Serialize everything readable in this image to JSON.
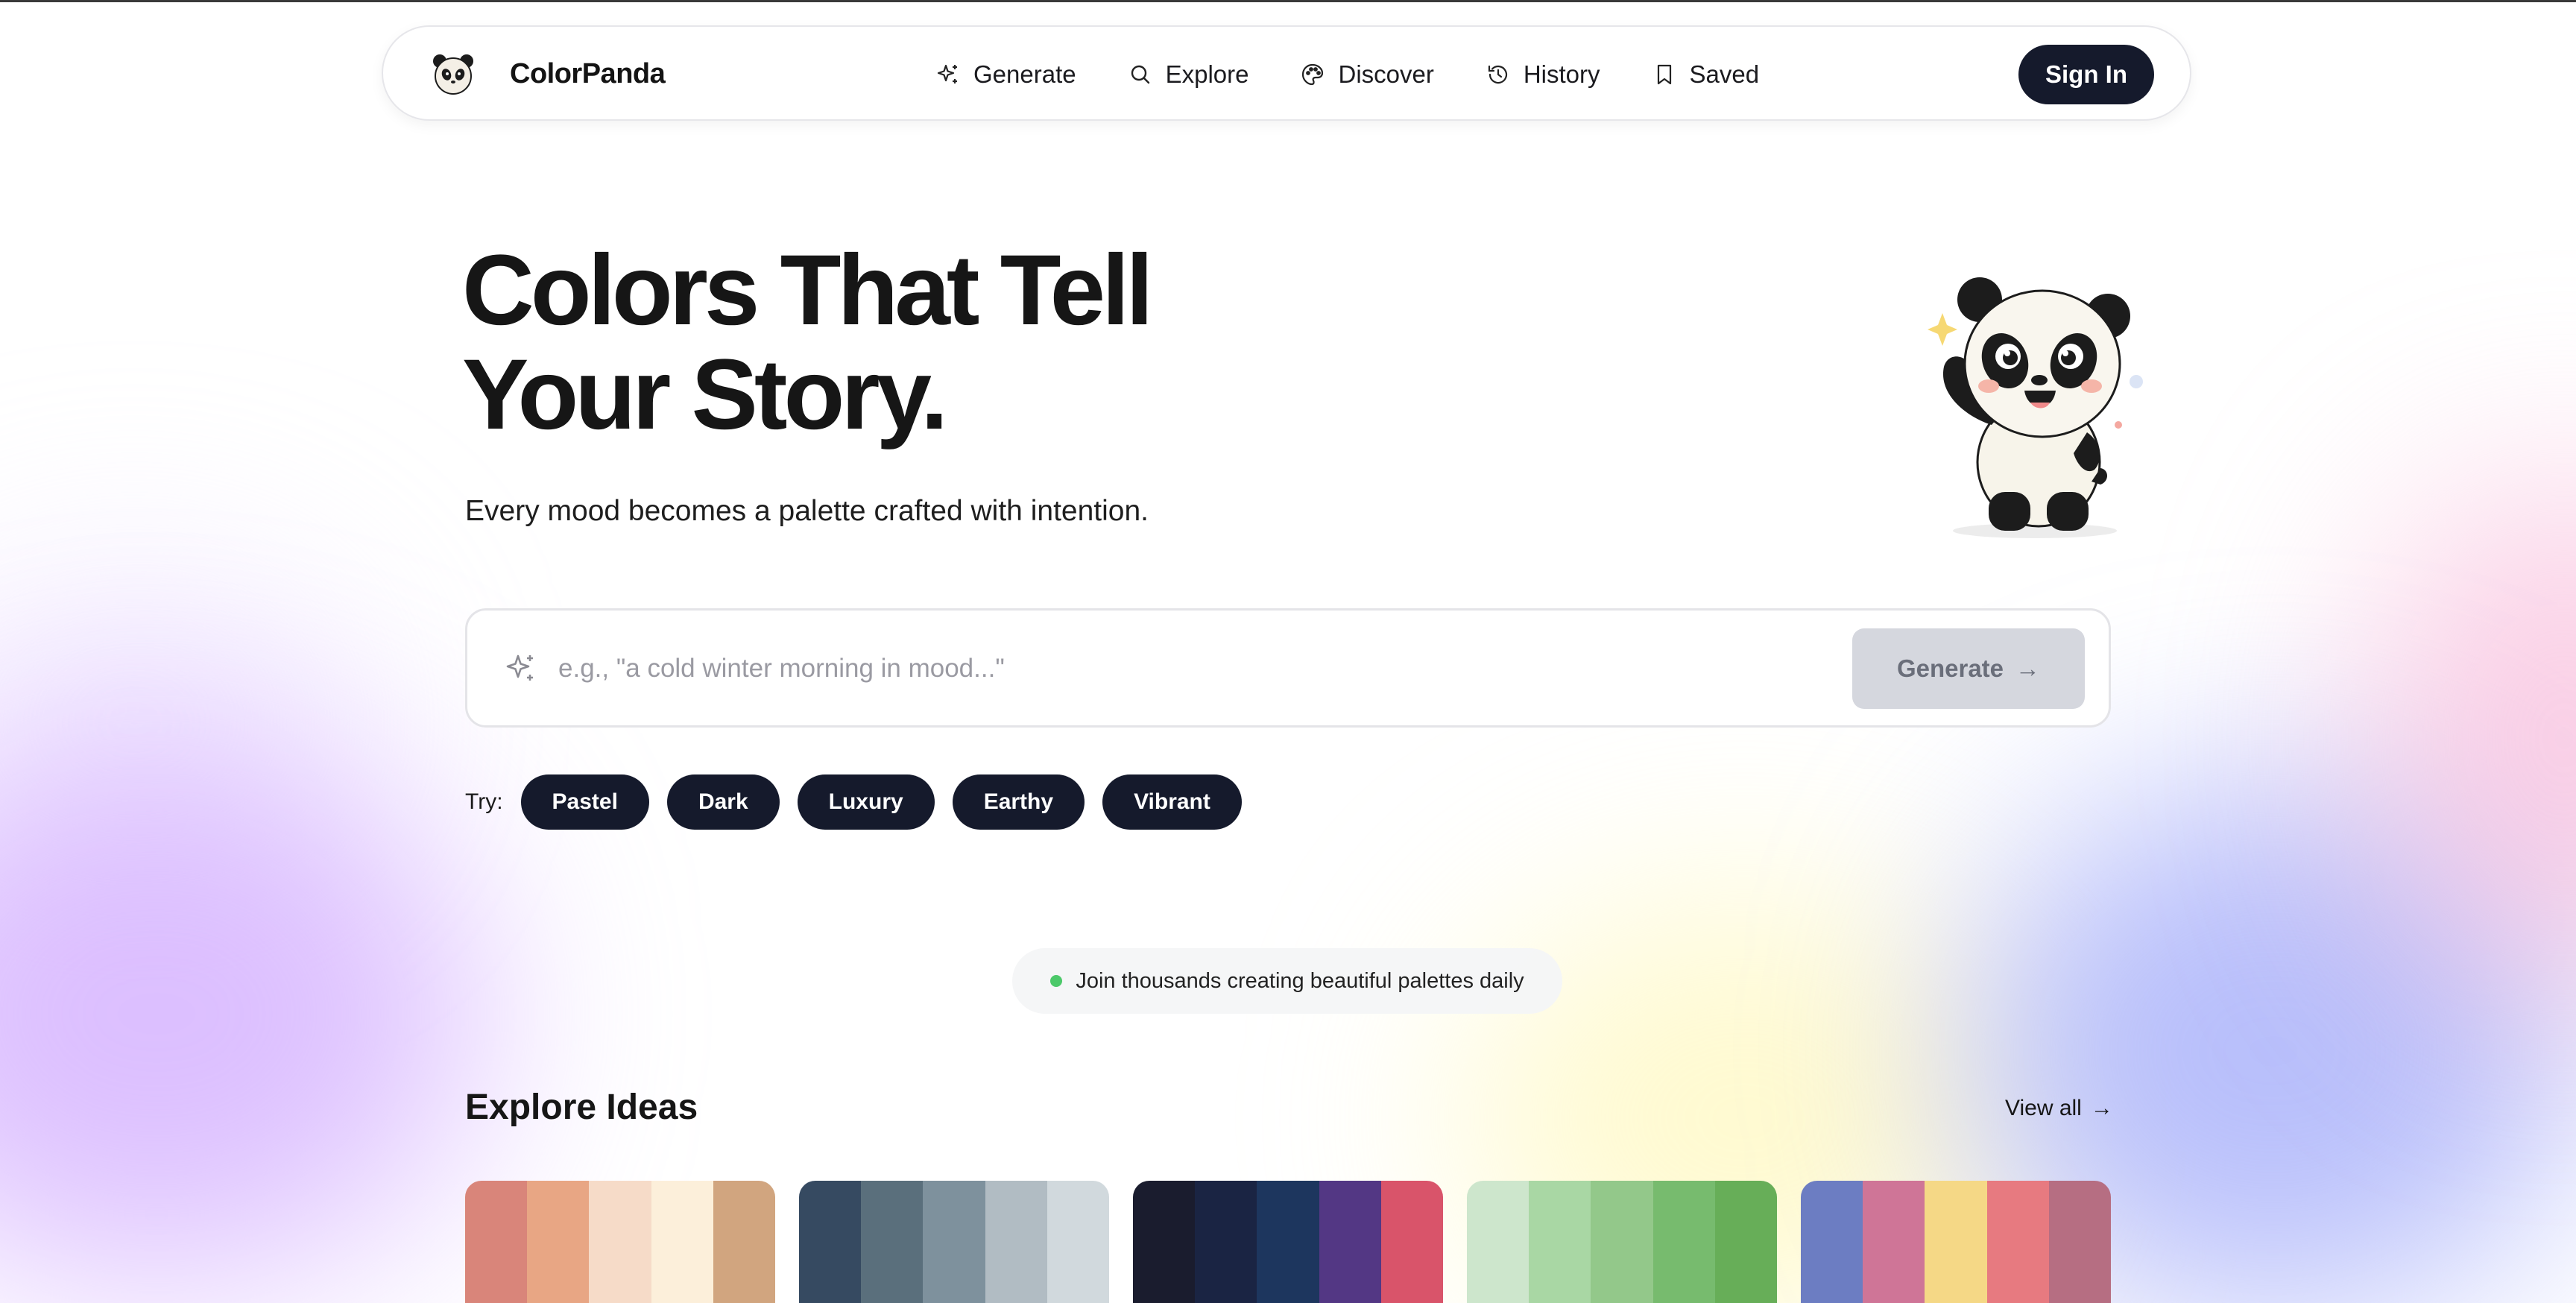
{
  "nav": {
    "brand": "ColorPanda",
    "links": [
      {
        "label": "Generate",
        "icon": "sparkle-icon"
      },
      {
        "label": "Explore",
        "icon": "search-icon"
      },
      {
        "label": "Discover",
        "icon": "palette-icon"
      },
      {
        "label": "History",
        "icon": "history-icon"
      },
      {
        "label": "Saved",
        "icon": "bookmark-icon"
      }
    ],
    "sign_in": "Sign In"
  },
  "hero": {
    "title_line1": "Colors That Tell",
    "title_line2": "Your Story.",
    "subtitle": "Every mood becomes a palette crafted with intention."
  },
  "search": {
    "placeholder": "e.g., \"a cold winter morning in mood...\"",
    "value": "",
    "button_label": "Generate",
    "button_arrow": "→"
  },
  "try": {
    "label": "Try:",
    "chips": [
      "Pastel",
      "Dark",
      "Luxury",
      "Earthy",
      "Vibrant"
    ]
  },
  "join_badge": "Join thousands creating beautiful palettes daily",
  "explore": {
    "title": "Explore Ideas",
    "view_all": "View all",
    "view_all_arrow": "→",
    "palettes": [
      [
        "#D9857A",
        "#E8A684",
        "#F6DBC8",
        "#FCEFDA",
        "#D1A57F"
      ],
      [
        "#364A61",
        "#5A6F7C",
        "#7E919D",
        "#B1BCC3",
        "#D1D9DD"
      ],
      [
        "#1A1C2E",
        "#1A2443",
        "#1D365E",
        "#533784",
        "#D9546A"
      ],
      [
        "#CDE6CC",
        "#A9D7A4",
        "#93C88A",
        "#77BB6E",
        "#67AE58"
      ],
      [
        "#6C7DC2",
        "#CF7597",
        "#F5D886",
        "#E77A80",
        "#B66E82"
      ]
    ]
  },
  "colors": {
    "dark_navy": "#151A2C",
    "disabled_button": "#D5D7DE",
    "status_green": "#4CC96A"
  }
}
